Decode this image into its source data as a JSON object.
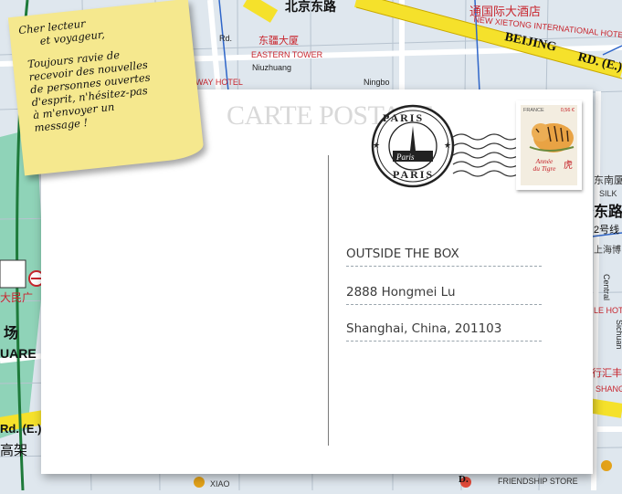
{
  "map": {
    "labels_cn": {
      "beijing_road": "北京东路",
      "hotel_cn": "通国际大酒店",
      "eastern_tower_cn": "东疆大厦",
      "renmin": "大民广",
      "east_road": "东路",
      "line2": "2号线",
      "shangha": "上海博",
      "high": "高架",
      "field": "场",
      "dongnan": "东南厦",
      "hangzhou": "行汇丰"
    },
    "labels_en": {
      "hotel": "NEW XIETONG INTERNATIONAL HOTEL",
      "eastern_tower": "EASTERN TOWER",
      "way_hotel": "WAY HOTEL",
      "beijing": "BEIJING",
      "beijing_rd": "RD. (E.)",
      "niuzhuang": "Niuzhuang",
      "ningbo": "Ningbo",
      "rd": "Rd.",
      "square": "UARE",
      "central": "Central",
      "sichuan": "Sichuan",
      "le_hotel": "LE HOTEL",
      "shangh": "SHANGH",
      "silk": "SILK",
      "rd_e": "Rd. (E.)",
      "friendship": "FRIENDSHIP STORE",
      "d": "D.",
      "xiao": "XIAO"
    }
  },
  "postcard": {
    "heading": "CARTE POSTALE",
    "address": [
      "OUTSIDE THE BOX",
      "2888 Hongmei Lu",
      "Shanghai, China, 201103"
    ]
  },
  "stamp": {
    "country": "FRANCE",
    "price": "0,56 €",
    "caption_line1": "Année",
    "caption_line2": "du Tigre",
    "glyph": "虎"
  },
  "postmark": {
    "top_text": "PARIS",
    "center_text": "Paris",
    "bottom_text": "PARIS"
  },
  "sticky_note": {
    "greeting_line1": "Cher lecteur",
    "greeting_line2": "et voyageur,",
    "body": [
      "Toujours ravie de",
      "recevoir des nouvelles",
      "de personnes ouvertes",
      "d'esprit, n'hésitez-pas",
      "à m'envoyer un",
      "message !"
    ]
  },
  "colors": {
    "road_yellow": "#f5e12b",
    "road_blue": "#2f66c9",
    "map_bg": "#dde6ee",
    "sticky": "#f5e88e",
    "stamp_red": "#c42026"
  }
}
